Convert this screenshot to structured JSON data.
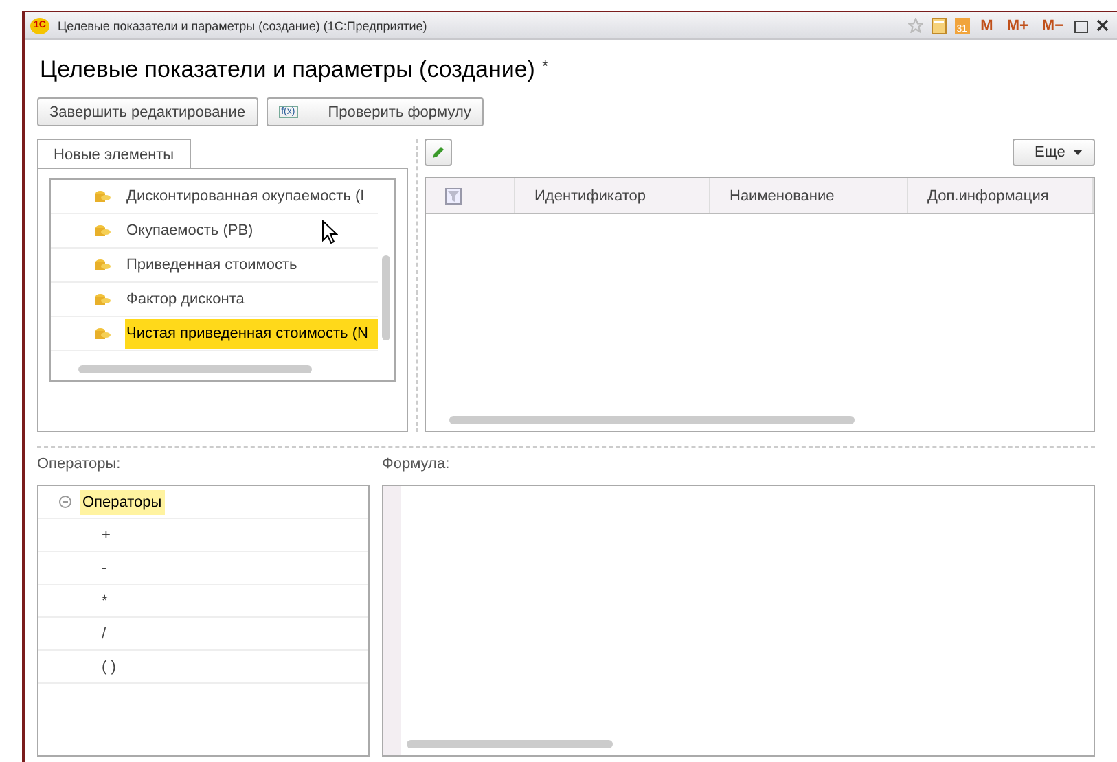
{
  "window": {
    "logo": "1С",
    "title": "Целевые показатели и параметры (создание)  (1С:Предприятие)",
    "calendar_day": "31",
    "memory_buttons": [
      "M",
      "M+",
      "M−"
    ]
  },
  "heading": {
    "title": "Целевые показатели и параметры (создание)",
    "modified_mark": "*"
  },
  "toolbar": {
    "buttons": [
      {
        "label": "Завершить редактирование",
        "kind": "text"
      },
      {
        "label": "Проверить формулу",
        "icon_text": "f(x)",
        "kind": "icon"
      }
    ]
  },
  "tabs": [
    {
      "label": "Новые элементы",
      "selected": true
    }
  ],
  "elements": [
    {
      "label": "Дисконтированная окупаемость (I",
      "selected": false
    },
    {
      "label": "Окупаемость (PB)",
      "selected": false
    },
    {
      "label": "Приведенная стоимость",
      "selected": false
    },
    {
      "label": "Фактор дисконта",
      "selected": false
    },
    {
      "label": "Чистая приведенная стоимость (N",
      "selected": true
    }
  ],
  "table": {
    "more_button": "Еще",
    "columns": [
      "Идентификатор",
      "Наименование",
      "Доп.информация"
    ]
  },
  "operators": {
    "label": "Операторы:",
    "root": {
      "label": "Операторы",
      "expanded": true,
      "selected": true,
      "children": [
        {
          "label": "+"
        },
        {
          "label": "-"
        },
        {
          "label": "*"
        },
        {
          "label": "/"
        },
        {
          "label": "( )"
        }
      ]
    }
  },
  "formula": {
    "label": "Формула:"
  }
}
